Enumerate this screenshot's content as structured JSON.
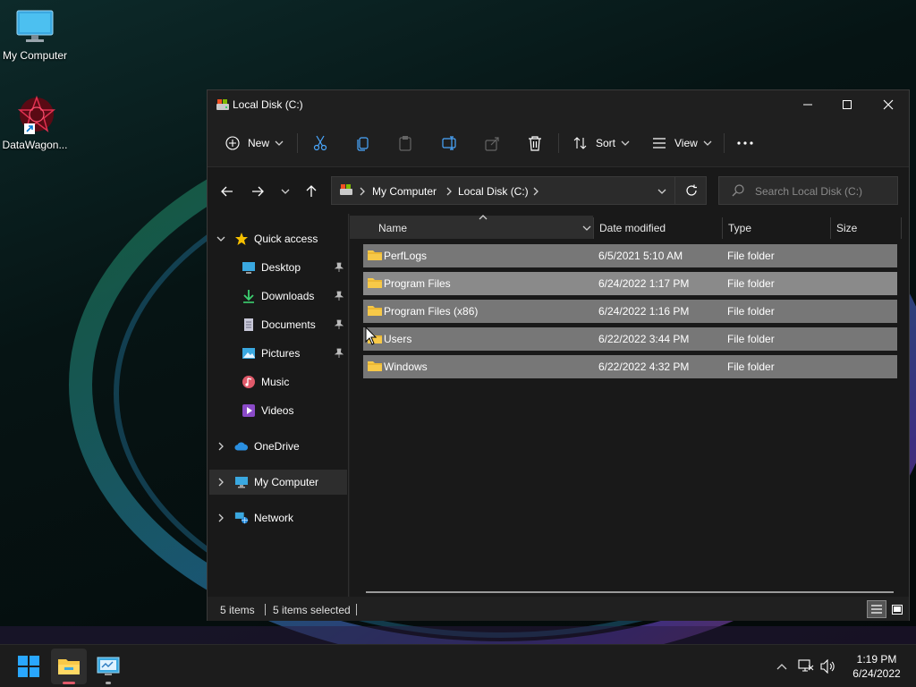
{
  "desktop": {
    "icons": [
      {
        "label": "My Computer",
        "icon": "monitor-icon"
      },
      {
        "label": "DataWagon...",
        "icon": "datawagon-shortcut-icon"
      }
    ]
  },
  "window": {
    "title": "Local Disk (C:)",
    "controls": {
      "minimize": "minimize-icon",
      "maximize": "maximize-icon",
      "close": "close-icon"
    }
  },
  "toolbar": {
    "new_label": "New",
    "sort_label": "Sort",
    "view_label": "View",
    "actions": [
      "cut-icon",
      "copy-icon",
      "paste-icon",
      "rename-icon",
      "share-icon",
      "delete-icon"
    ],
    "more": "more-options-icon"
  },
  "address": {
    "crumbs": [
      "My Computer",
      "Local Disk (C:)"
    ],
    "search_placeholder": "Search Local Disk (C:)"
  },
  "nav": {
    "quick_access": "Quick access",
    "items": [
      {
        "label": "Desktop",
        "icon": "desktop-icon",
        "pinned": true
      },
      {
        "label": "Downloads",
        "icon": "downloads-icon",
        "pinned": true
      },
      {
        "label": "Documents",
        "icon": "documents-icon",
        "pinned": true
      },
      {
        "label": "Pictures",
        "icon": "pictures-icon",
        "pinned": true
      },
      {
        "label": "Music",
        "icon": "music-icon",
        "pinned": false
      },
      {
        "label": "Videos",
        "icon": "videos-icon",
        "pinned": false
      }
    ],
    "onedrive": "OneDrive",
    "my_computer": "My Computer",
    "network": "Network"
  },
  "columns": {
    "name": "Name",
    "date": "Date modified",
    "type": "Type",
    "size": "Size"
  },
  "files": [
    {
      "name": "PerfLogs",
      "date": "6/5/2021 5:10 AM",
      "type": "File folder",
      "size": ""
    },
    {
      "name": "Program Files",
      "date": "6/24/2022 1:17 PM",
      "type": "File folder",
      "size": ""
    },
    {
      "name": "Program Files (x86)",
      "date": "6/24/2022 1:16 PM",
      "type": "File folder",
      "size": ""
    },
    {
      "name": "Users",
      "date": "6/22/2022 3:44 PM",
      "type": "File folder",
      "size": ""
    },
    {
      "name": "Windows",
      "date": "6/22/2022 4:32 PM",
      "type": "File folder",
      "size": ""
    }
  ],
  "status": {
    "items": "5 items",
    "selected": "5 items selected"
  },
  "taskbar": {
    "time": "1:19 PM",
    "date": "6/24/2022",
    "apps": [
      "start-icon",
      "file-explorer-icon",
      "control-panel-icon"
    ]
  },
  "colors": {
    "accent": "#0078d4",
    "folder": "#f7c948",
    "selection": "#777777",
    "star": "#f6c000"
  }
}
